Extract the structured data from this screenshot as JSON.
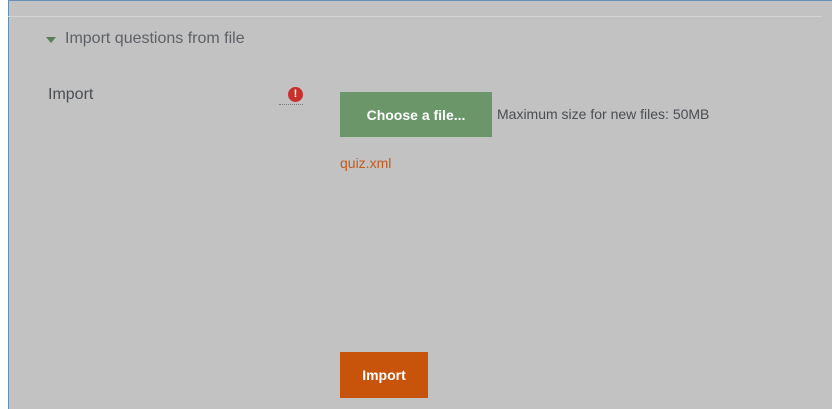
{
  "section": {
    "title": "Import questions from file",
    "expanded": true,
    "caret_icon": "caret-down-icon"
  },
  "import_field": {
    "label": "Import",
    "required_icon": "exclamation-circle-icon",
    "required_symbol": "!",
    "choose_button_label": "Choose a file...",
    "max_size_text": "Maximum size for new files: 50MB",
    "selected_file": "quiz.xml"
  },
  "actions": {
    "import_label": "Import"
  },
  "colors": {
    "panel_background": "#c2c2c2",
    "choose_button": "#6a966a",
    "import_button": "#c8540c",
    "file_link": "#c45a1c",
    "required_icon": "#c9302c"
  }
}
